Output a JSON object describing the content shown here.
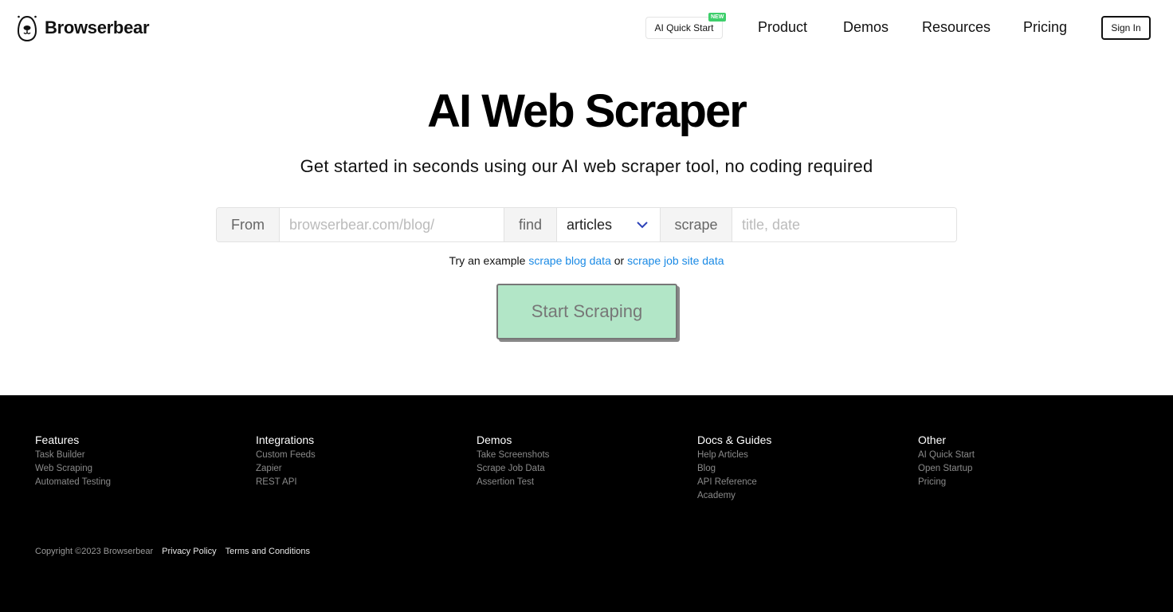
{
  "header": {
    "brand": "Browserbear",
    "quick_start": "AI Quick Start",
    "new_badge": "NEW",
    "nav": [
      "Product",
      "Demos",
      "Resources",
      "Pricing"
    ],
    "sign_in": "Sign In"
  },
  "hero": {
    "title": "AI Web Scraper",
    "subtitle": "Get started in seconds using our AI web scraper tool, no coding required",
    "form": {
      "from_label": "From",
      "url_placeholder": "browserbear.com/blog/",
      "find_label": "find",
      "find_selected": "articles",
      "scrape_label": "scrape",
      "fields_placeholder": "title, date"
    },
    "examples": {
      "prefix": "Try an example",
      "link1": "scrape blog data",
      "or": "or",
      "link2": "scrape job site data"
    },
    "start_button": "Start Scraping"
  },
  "footer": {
    "columns": [
      {
        "title": "Features",
        "links": [
          "Task Builder",
          "Web Scraping",
          "Automated Testing"
        ]
      },
      {
        "title": "Integrations",
        "links": [
          "Custom Feeds",
          "Zapier",
          "REST API"
        ]
      },
      {
        "title": "Demos",
        "links": [
          "Take Screenshots",
          "Scrape Job Data",
          "Assertion Test"
        ]
      },
      {
        "title": "Docs & Guides",
        "links": [
          "Help Articles",
          "Blog",
          "API Reference",
          "Academy"
        ]
      },
      {
        "title": "Other",
        "links": [
          "AI Quick Start",
          "Open Startup",
          "Pricing"
        ]
      }
    ],
    "copyright": "Copyright ©2023 Browserbear",
    "privacy": "Privacy Policy",
    "terms": "Terms and Conditions"
  },
  "colors": {
    "link": "#1a8ae5",
    "start_button_bg": "#b2e6c7",
    "new_badge": "#3ecf6b",
    "footer_bg": "#000000"
  }
}
